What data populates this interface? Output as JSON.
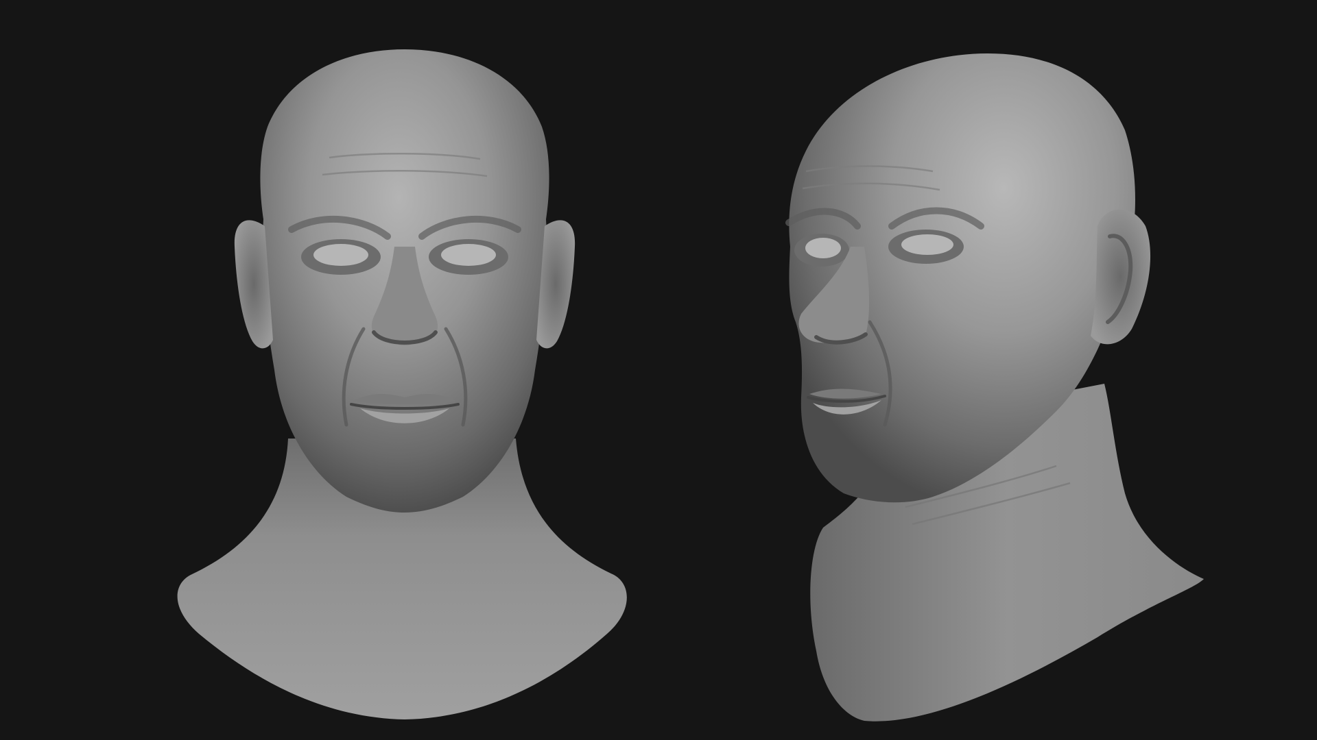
{
  "scene": {
    "background_color": "#151515",
    "clay_color": "#8f8f8f",
    "views": [
      {
        "name": "front-view"
      },
      {
        "name": "three-quarter-view"
      }
    ]
  }
}
